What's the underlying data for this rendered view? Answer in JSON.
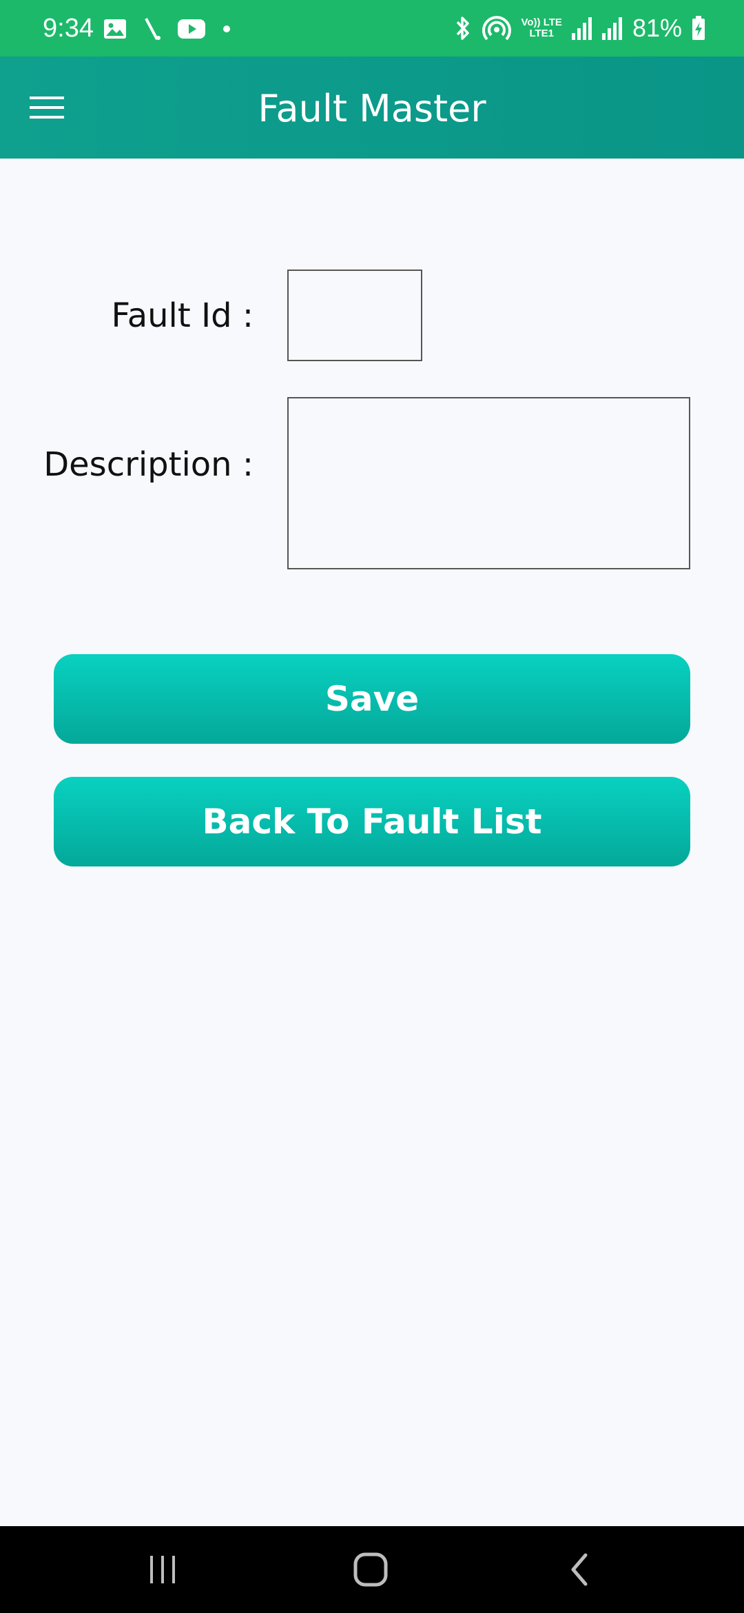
{
  "status_bar": {
    "time": "9:34",
    "battery": "81%",
    "network_line1": "Vo)) LTE",
    "network_line2": "LTE1",
    "left_icons": [
      "gallery-icon",
      "signal-slash-icon",
      "youtube-icon",
      "dot-icon"
    ],
    "right_icons": [
      "bluetooth-icon",
      "hotspot-icon",
      "signal-bars-icon",
      "signal-bars-icon",
      "battery-charging-icon"
    ]
  },
  "app_bar": {
    "title": "Fault Master",
    "menu_icon": "hamburger-menu-icon"
  },
  "form": {
    "fault_id_label": "Fault Id :",
    "fault_id_value": "",
    "description_label": "Description :",
    "description_value": ""
  },
  "buttons": {
    "save_label": "Save",
    "back_label": "Back To Fault List"
  },
  "nav_bar": {
    "icons": [
      "recent-apps-icon",
      "home-icon",
      "back-icon"
    ]
  },
  "colors": {
    "status_bar": "#1cb96a",
    "app_bar": "#0a9587",
    "button": "#06bfae",
    "background": "#f7f9fd"
  }
}
